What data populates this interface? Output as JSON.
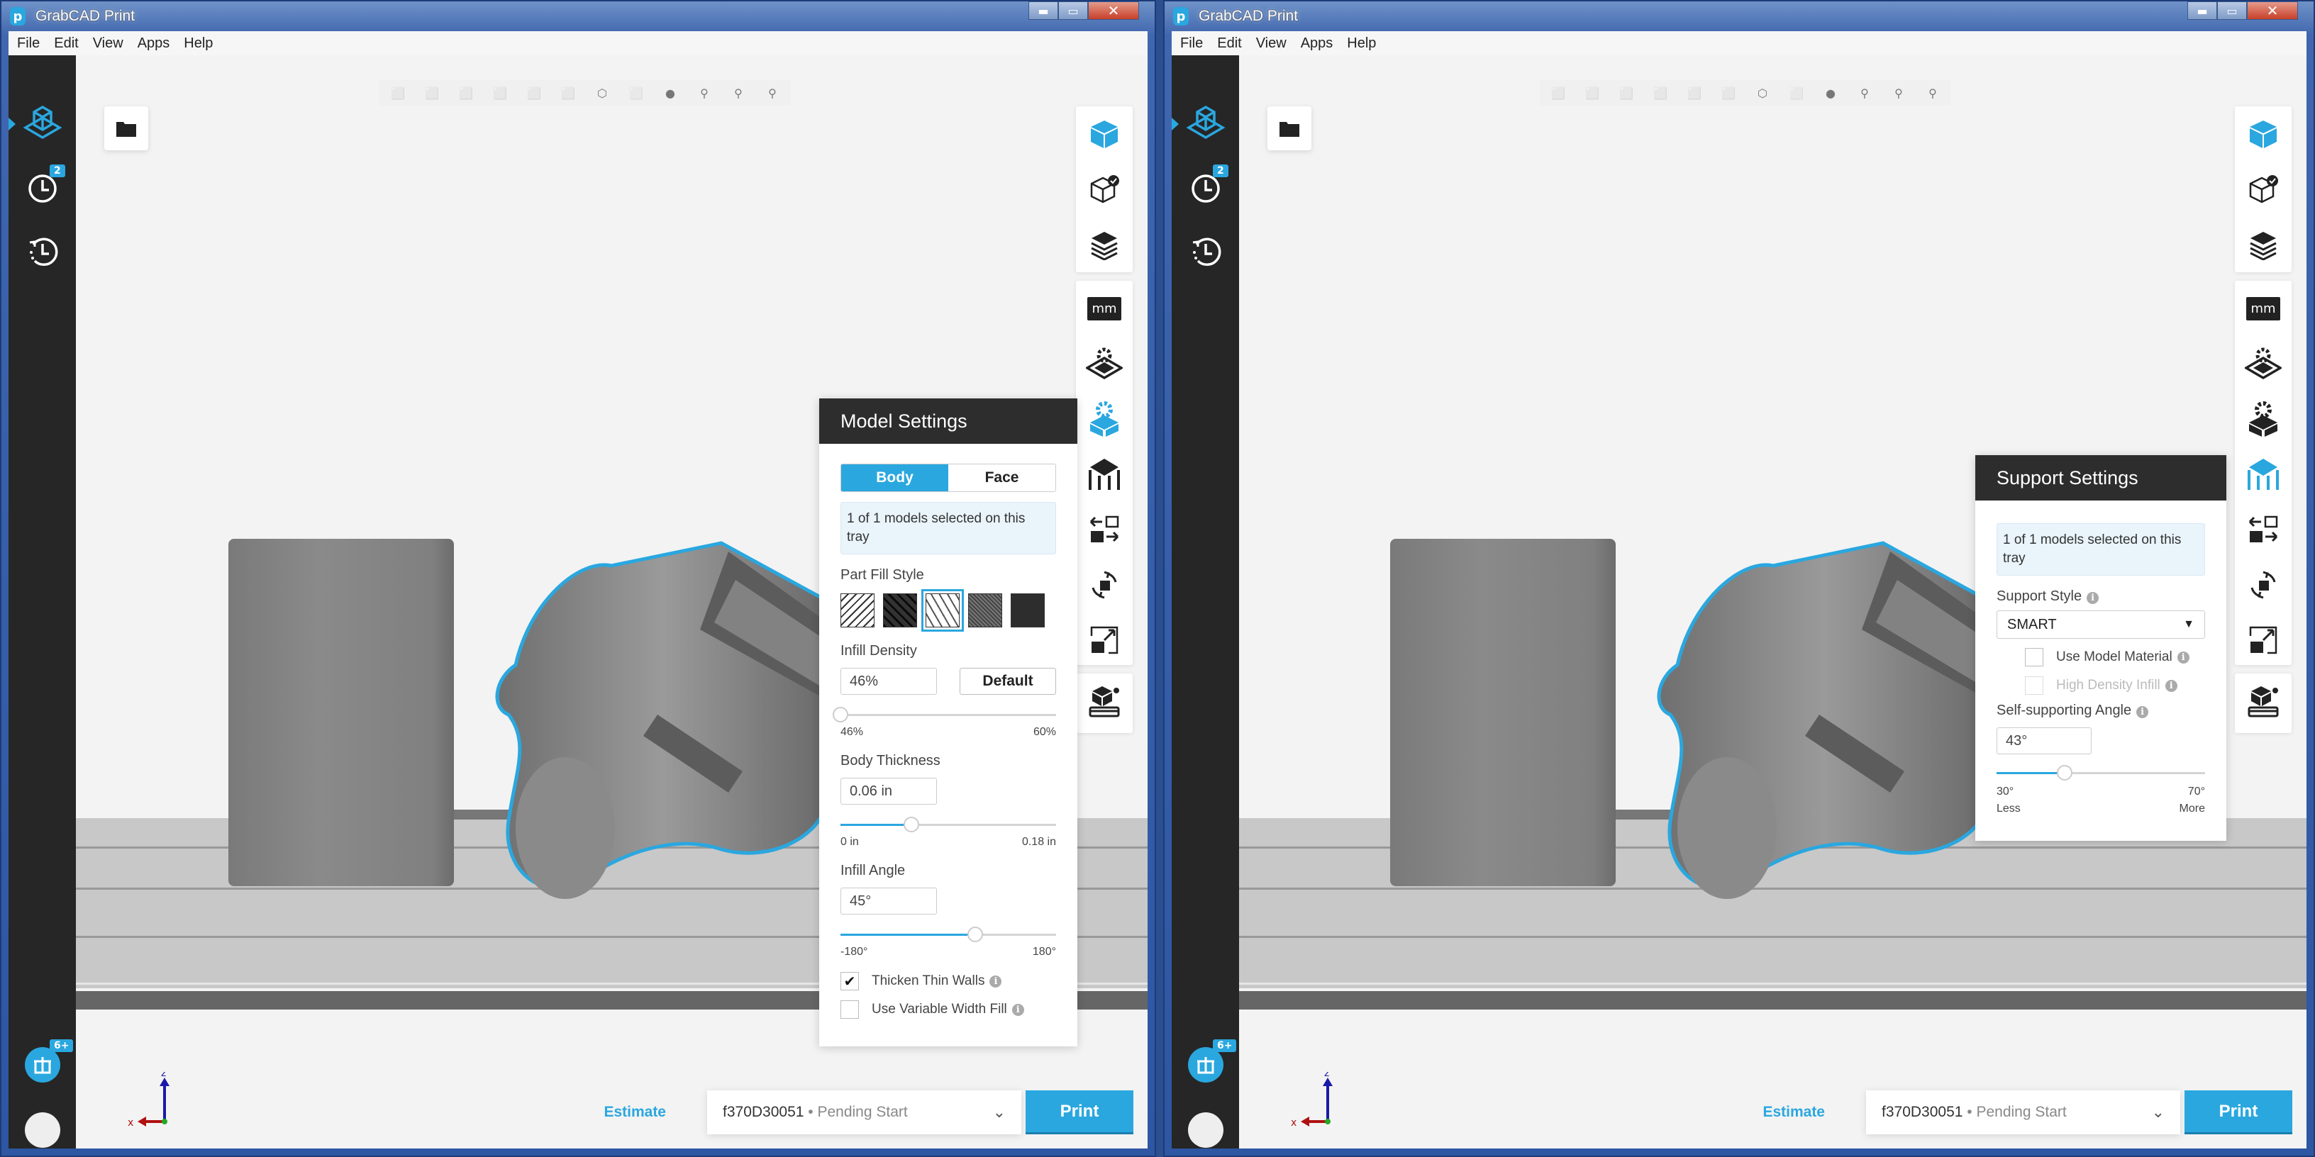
{
  "windows": [
    {
      "id": "left",
      "title": "GrabCAD Print",
      "menu": [
        "File",
        "Edit",
        "View",
        "Apps",
        "Help"
      ],
      "sidebar": {
        "queue_badge": "2",
        "apps_badge": "6+"
      },
      "panel": {
        "type": "model-settings",
        "title": "Model Settings",
        "tabs": [
          {
            "label": "Body",
            "active": true
          },
          {
            "label": "Face",
            "active": false
          }
        ],
        "selection_info": "1 of 1 models selected on this tray",
        "part_fill_style_label": "Part Fill Style",
        "fill_styles": [
          "sparse",
          "sparse-double-dense",
          "hexagonal",
          "sparse-high-density",
          "solid"
        ],
        "fill_style_selected": "hexagonal",
        "infill_density": {
          "label": "Infill Density",
          "value": "46%",
          "default_label": "Default",
          "min": "46%",
          "max": "60%",
          "fraction": 0.0
        },
        "body_thickness": {
          "label": "Body Thickness",
          "value": "0.06 in",
          "min": "0 in",
          "max": "0.18 in",
          "fraction": 0.33
        },
        "infill_angle": {
          "label": "Infill Angle",
          "value": "45°",
          "min": "-180°",
          "max": "180°",
          "fraction": 0.625
        },
        "thicken_thin_walls": {
          "label": "Thicken Thin Walls",
          "checked": true
        },
        "variable_width_fill": {
          "label": "Use Variable Width Fill",
          "checked": false
        }
      },
      "footer": {
        "estimate": "Estimate",
        "printer": "f370D30051",
        "printer_status": " • Pending Start",
        "print": "Print"
      }
    },
    {
      "id": "right",
      "title": "GrabCAD Print",
      "menu": [
        "File",
        "Edit",
        "View",
        "Apps",
        "Help"
      ],
      "sidebar": {
        "queue_badge": "2",
        "apps_badge": "6+"
      },
      "panel": {
        "type": "support-settings",
        "title": "Support Settings",
        "selection_info": "1 of 1 models selected on this tray",
        "support_style": {
          "label": "Support Style",
          "value": "SMART"
        },
        "use_model_material": {
          "label": "Use Model Material",
          "checked": false
        },
        "high_density_infill": {
          "label": "High Density Infill",
          "checked": false,
          "disabled": true
        },
        "self_supporting_angle": {
          "label": "Self-supporting Angle",
          "value": "43°",
          "min": "30°",
          "max": "70°",
          "min_caption": "Less",
          "max_caption": "More",
          "fraction": 0.325
        }
      },
      "footer": {
        "estimate": "Estimate",
        "printer": "f370D30051",
        "printer_status": " • Pending Start",
        "print": "Print"
      }
    }
  ],
  "axis": {
    "x": "x",
    "z": "z"
  },
  "colors": {
    "accent": "#2aa7df",
    "sidebar": "#262626",
    "panel_header": "#2d2d2d"
  }
}
